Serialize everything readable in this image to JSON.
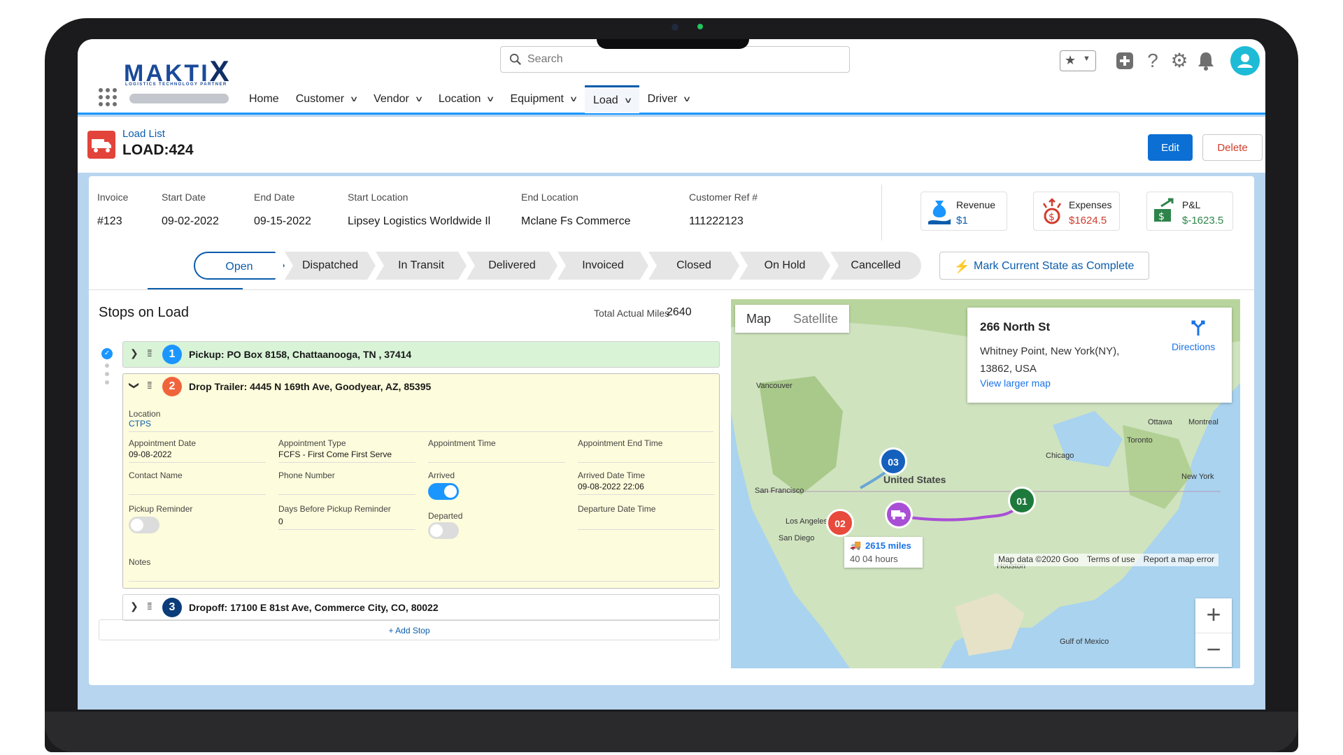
{
  "header": {
    "logo_main": "MAKTI",
    "logo_x": "X",
    "logo_sub": "LOGISTICS TECHNOLOGY PARTNER",
    "search_placeholder": "Search",
    "icons": [
      "favorites-star-icon",
      "add-icon",
      "help-icon",
      "gear-icon",
      "bell-icon",
      "avatar-icon"
    ]
  },
  "nav": [
    {
      "label": "Home",
      "dropdown": false,
      "active": false
    },
    {
      "label": "Customer",
      "dropdown": true,
      "active": false
    },
    {
      "label": "Vendor",
      "dropdown": true,
      "active": false
    },
    {
      "label": "Location",
      "dropdown": true,
      "active": false
    },
    {
      "label": "Equipment",
      "dropdown": true,
      "active": false
    },
    {
      "label": "Load",
      "dropdown": true,
      "active": true
    },
    {
      "label": "Driver",
      "dropdown": true,
      "active": false
    }
  ],
  "page": {
    "breadcrumb": "Load List",
    "title": "LOAD:424",
    "edit_label": "Edit",
    "delete_label": "Delete"
  },
  "summary": {
    "invoice_label": "Invoice",
    "invoice": "#123",
    "start_date_label": "Start Date",
    "start_date": "09-02-2022",
    "end_date_label": "End Date",
    "end_date": "09-15-2022",
    "start_location_label": "Start Location",
    "start_location": "Lipsey Logistics Worldwide Il",
    "end_location_label": "End Location",
    "end_location": "Mclane Fs Commerce",
    "customer_ref_label": "Customer Ref #",
    "customer_ref": "111222123"
  },
  "kpis": {
    "revenue": {
      "label": "Revenue",
      "value": "$1",
      "color": "#0b5cab"
    },
    "expenses": {
      "label": "Expenses",
      "value": "$1624.5",
      "color": "#d13b2b"
    },
    "pl": {
      "label": "P&L",
      "value": "$-1623.5",
      "color": "#2e844a"
    }
  },
  "path": {
    "steps": [
      "Open",
      "Dispatched",
      "In Transit",
      "Delivered",
      "Invoiced",
      "Closed",
      "On Hold",
      "Cancelled"
    ],
    "current": "Open",
    "mark_complete": "Mark Current State as Complete"
  },
  "stops": {
    "title": "Stops on Load",
    "total_miles_label": "Total Actual Miles",
    "total_miles": "2640",
    "items": [
      {
        "num": "1",
        "label": "Pickup: PO Box 8158, Chattaanooga, TN , 37414",
        "color": "#1b96ff"
      },
      {
        "num": "2",
        "label": "Drop Trailer: 4445 N 169th Ave, Goodyear, AZ, 85395",
        "color": "#f0643c"
      },
      {
        "num": "3",
        "label": "Dropoff: 17100 E 81st Ave, Commerce City, CO, 80022",
        "color": "#0b3c7a"
      }
    ],
    "detail": {
      "location_label": "Location",
      "location": "CTPS",
      "appt_date_label": "Appointment Date",
      "appt_date": "09-08-2022",
      "appt_type_label": "Appointment Type",
      "appt_type": "FCFS - First Come First Serve",
      "appt_time_label": "Appointment Time",
      "appt_end_label": "Appointment End Time",
      "contact_label": "Contact Name",
      "phone_label": "Phone Number",
      "arrived_label": "Arrived",
      "arrived": true,
      "arrived_dt_label": "Arrived Date Time",
      "arrived_dt": "09-08-2022 22:06",
      "pickup_reminder_label": "Pickup Reminder",
      "pickup_reminder": false,
      "days_before_label": "Days Before Pickup Reminder",
      "days_before": "0",
      "departed_label": "Departed",
      "departed": false,
      "departure_dt_label": "Departure Date Time",
      "notes_label": "Notes"
    },
    "add_stop": "+ Add Stop"
  },
  "map": {
    "tab_map": "Map",
    "tab_satellite": "Satellite",
    "popup_title": "266 North St",
    "popup_address": "Whitney Point, New York(NY), 13862, USA",
    "popup_link": "View larger map",
    "directions": "Directions",
    "route_miles": "2615 miles",
    "route_hours": "40 04 hours",
    "attribution": [
      "Map data ©2020 Goo",
      "Terms of use",
      "Report a map error"
    ],
    "markers": [
      {
        "label": "01",
        "color": "#1e7a3c"
      },
      {
        "label": "02",
        "color": "#e84a3c"
      },
      {
        "label": "03",
        "color": "#1560bd"
      }
    ],
    "labels": [
      "Vancouver",
      "United States",
      "San Francisco",
      "Los Angeles",
      "San Diego",
      "Chicago",
      "Toronto",
      "Ottawa",
      "Montreal",
      "New York",
      "Houston",
      "Gulf of Mexico"
    ],
    "zoom_in": "+",
    "zoom_out": "−"
  }
}
